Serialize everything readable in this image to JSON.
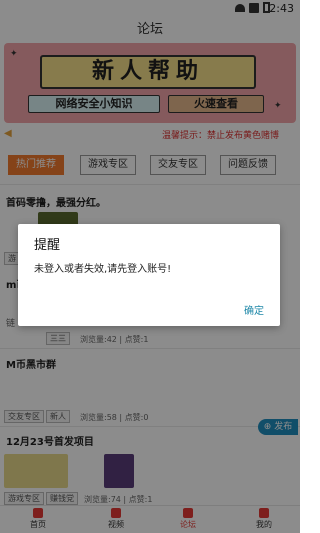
{
  "status_bar": {
    "time": "2:43"
  },
  "app_bar": {
    "title": "论坛"
  },
  "banner": {
    "title": "新人帮助",
    "left_text": "网络安全小知识",
    "right_text": "火速查看"
  },
  "notice": {
    "text": "温馨提示：禁止发布黄色赌博"
  },
  "tabs": [
    {
      "label": "热门推荐",
      "active": true
    },
    {
      "label": "游戏专区",
      "active": false
    },
    {
      "label": "交友专区",
      "active": false
    },
    {
      "label": "问题反馈",
      "active": false
    }
  ],
  "posts": {
    "p1": {
      "title": "首码零撸，最强分红。"
    },
    "p2": {
      "title_partial": "m币",
      "chip_fragment": "游",
      "chip1": "三三",
      "stats": "浏览量:42 | 点赞:1",
      "side_label": "链"
    },
    "p3": {
      "title": "M币黑市群",
      "chip1": "交友专区",
      "chip2": "新人",
      "stats": "浏览量:58 | 点赞:0"
    },
    "p4": {
      "title": "12月23号首发项目",
      "chip1": "游戏专区",
      "chip2": "赚钱党",
      "stats": "浏览量:74 | 点赞:1"
    }
  },
  "dialog": {
    "title": "提醒",
    "message": "未登入或者失效,请先登入账号!",
    "confirm": "确定"
  },
  "fab": {
    "label": "发布"
  },
  "bottom_nav": [
    {
      "label": "首页",
      "icon": "home-icon",
      "active": false
    },
    {
      "label": "视频",
      "icon": "video-icon",
      "active": false
    },
    {
      "label": "论坛",
      "icon": "forum-icon",
      "active": true
    },
    {
      "label": "我的",
      "icon": "profile-icon",
      "active": false
    }
  ],
  "colors": {
    "accent": "#f37a2e",
    "link": "#1e88a8",
    "nav_active": "#e53935",
    "fab": "#1f8fbf"
  }
}
